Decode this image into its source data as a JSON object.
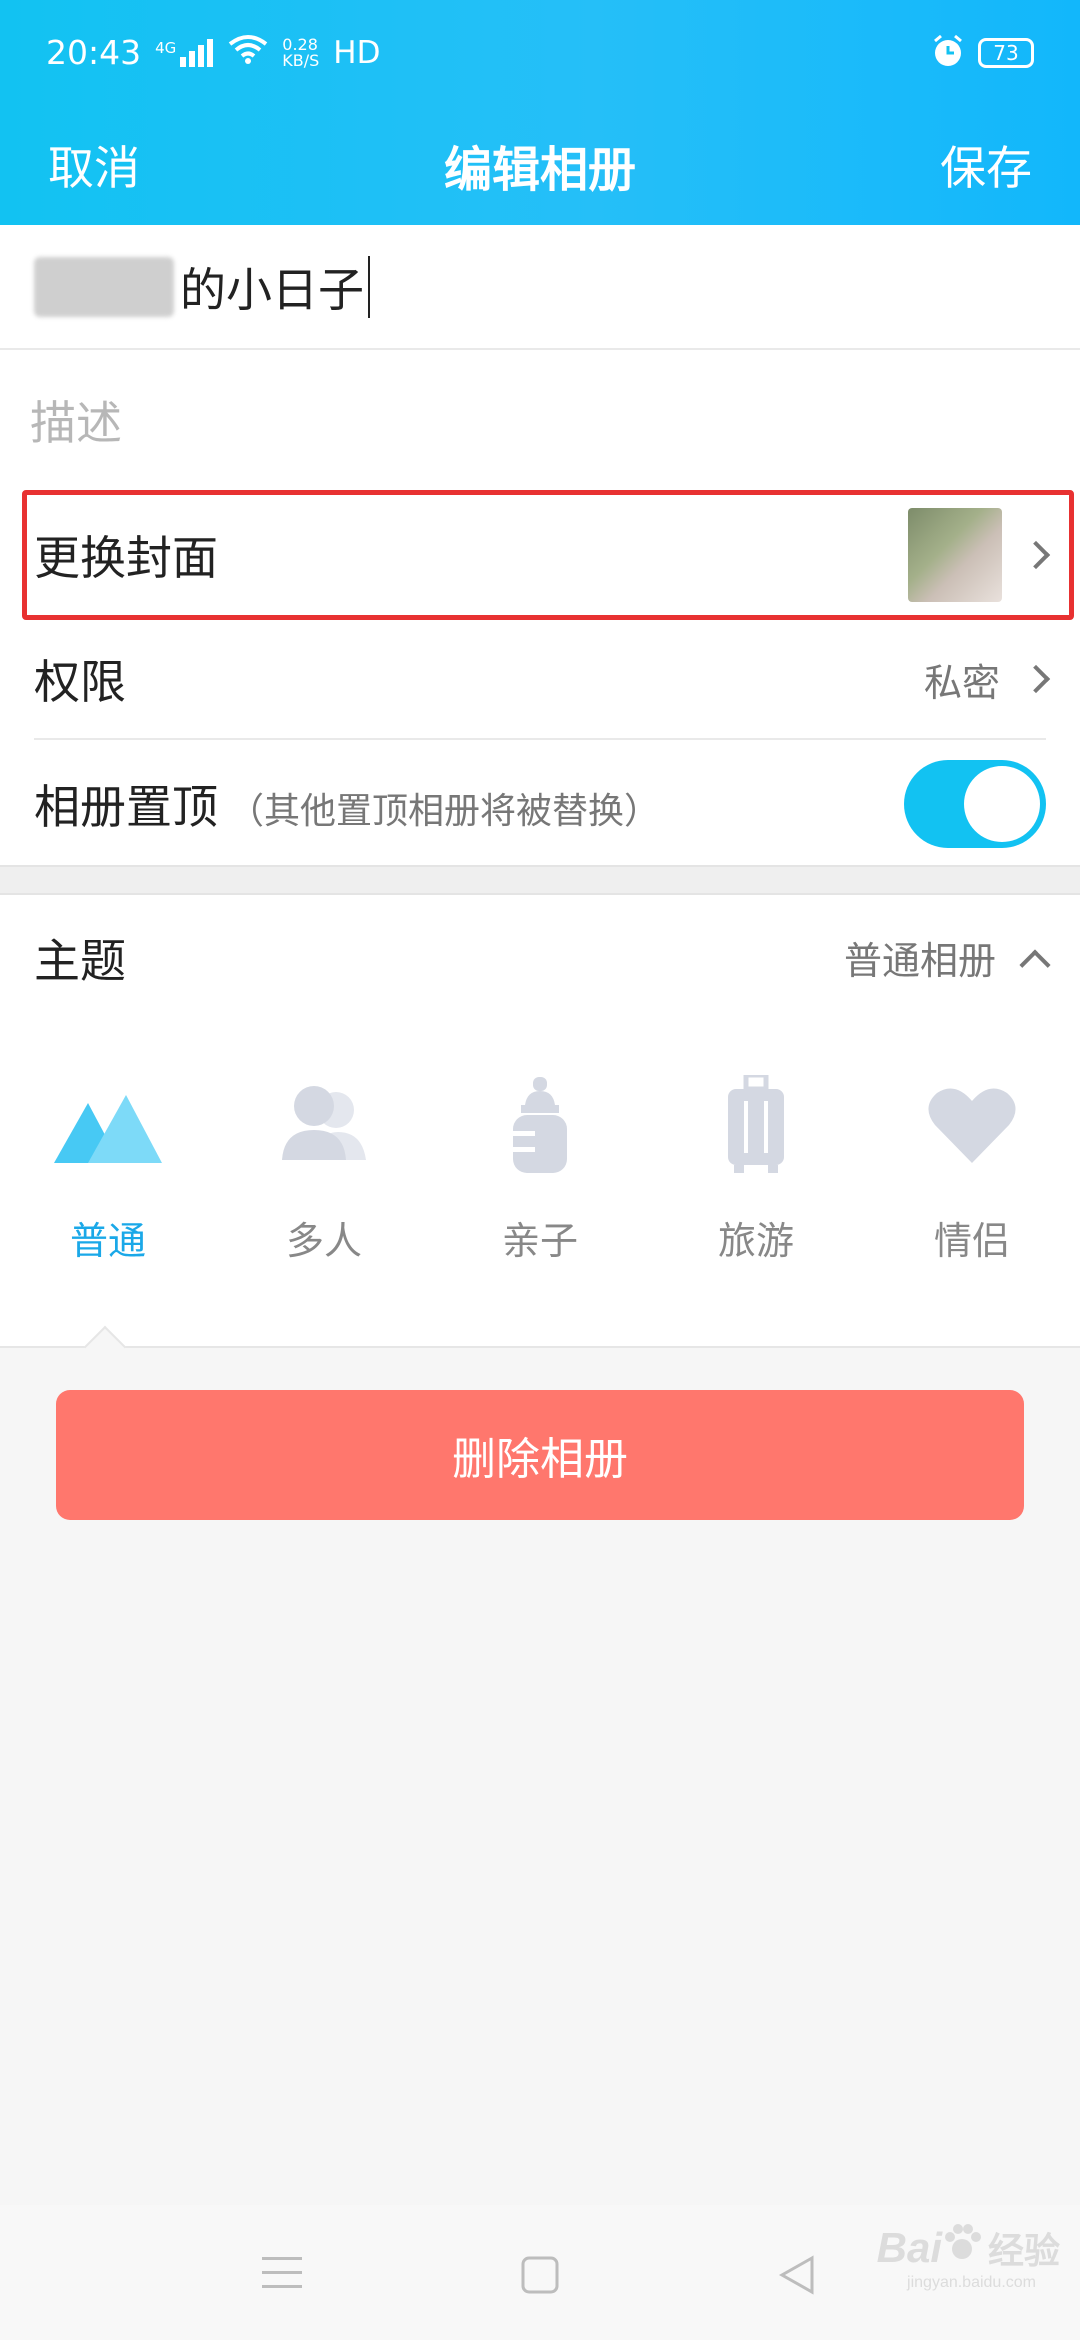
{
  "status_bar": {
    "time": "20:43",
    "network": "4G",
    "speed_value": "0.28",
    "speed_unit": "KB/S",
    "hd": "HD",
    "battery": "73"
  },
  "nav": {
    "cancel": "取消",
    "title": "编辑相册",
    "save": "保存"
  },
  "album_name": {
    "visible_text": "的小日子"
  },
  "description": {
    "placeholder": "描述"
  },
  "cover": {
    "label": "更换封面"
  },
  "permission": {
    "label": "权限",
    "value": "私密"
  },
  "pin_top": {
    "label": "相册置顶",
    "note": "（其他置顶相册将被替换）",
    "enabled": true
  },
  "theme": {
    "label": "主题",
    "current": "普通相册",
    "items": [
      {
        "label": "普通",
        "icon": "mountain-icon",
        "active": true
      },
      {
        "label": "多人",
        "icon": "people-icon",
        "active": false
      },
      {
        "label": "亲子",
        "icon": "baby-bottle-icon",
        "active": false
      },
      {
        "label": "旅游",
        "icon": "luggage-icon",
        "active": false
      },
      {
        "label": "情侣",
        "icon": "heart-icon",
        "active": false
      }
    ]
  },
  "delete_button": "删除相册",
  "colors": {
    "accent": "#12c2f2",
    "delete": "#ff776d",
    "highlight": "#e83131"
  },
  "watermark": {
    "brand": "Bai",
    "brand_cn": "经验",
    "domain": "jingyan.baidu.com"
  }
}
